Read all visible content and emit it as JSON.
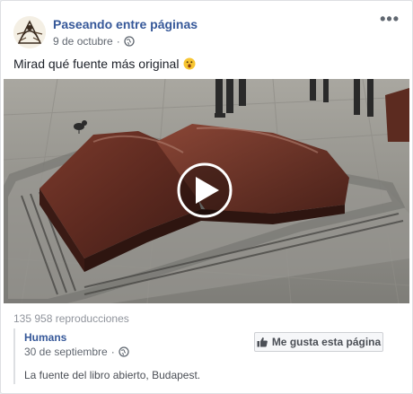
{
  "post": {
    "page_name": "Paseando entre páginas",
    "date": "9 de octubre",
    "separator": "·",
    "more_label": "•••",
    "text": "Mirad qué fuente más original",
    "emoji": "astonished-face-emoji",
    "views": "135 958 reproducciones"
  },
  "shared_page": {
    "name": "Humans",
    "date": "30 de septiembre",
    "separator": "·",
    "like_button_label": "Me gusta esta página",
    "description": "La fuente del libro abierto, Budapest."
  },
  "colors": {
    "link_blue": "#365899",
    "meta_gray": "#616770",
    "background": "#e9ebee"
  },
  "icons": [
    "globe-icon",
    "more-options-icon",
    "play-icon",
    "thumbs-up-icon"
  ]
}
